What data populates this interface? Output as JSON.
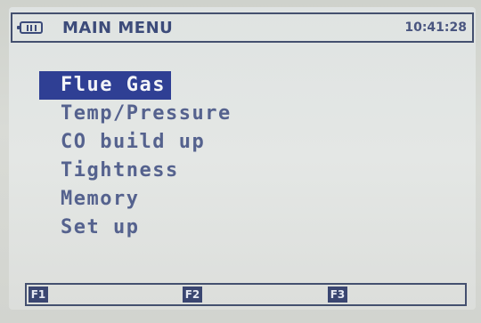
{
  "header": {
    "title": "MAIN MENU",
    "clock": "10:41:28",
    "battery_icon": "battery-icon"
  },
  "menu": {
    "items": [
      {
        "label": "Flue Gas",
        "selected": true
      },
      {
        "label": "Temp/Pressure",
        "selected": false
      },
      {
        "label": "CO build up",
        "selected": false
      },
      {
        "label": "Tightness",
        "selected": false
      },
      {
        "label": "Memory",
        "selected": false
      },
      {
        "label": "Set up",
        "selected": false
      }
    ]
  },
  "function_keys": [
    {
      "label": "F1"
    },
    {
      "label": "F2"
    },
    {
      "label": "F3"
    }
  ],
  "colors": {
    "text": "#3c4b7a",
    "highlight_bg": "#2f3f94",
    "screen_bg": "#e2e5e3"
  }
}
